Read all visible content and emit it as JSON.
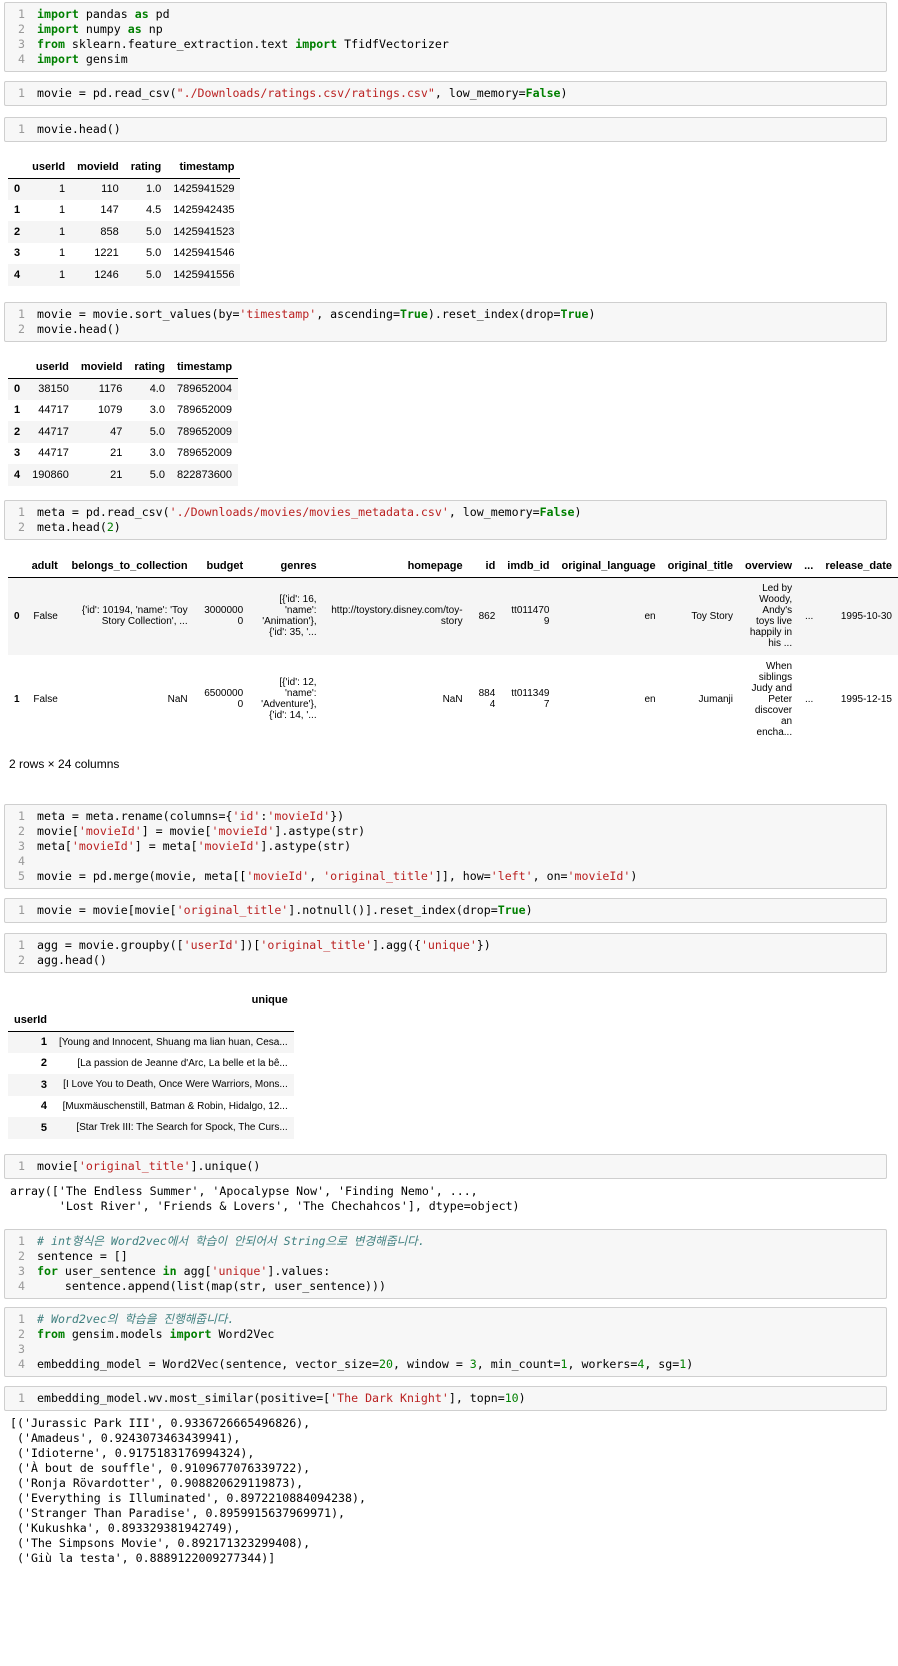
{
  "cells": {
    "c1": [
      "import pandas as pd",
      "import numpy as np",
      "from sklearn.feature_extraction.text import TfidfVectorizer",
      "import gensim"
    ],
    "c2": [
      "movie = pd.read_csv(\"./Downloads/ratings.csv/ratings.csv\", low_memory=False)"
    ],
    "c3": [
      "movie.head()"
    ],
    "c4": [
      "movie = movie.sort_values(by='timestamp', ascending=True).reset_index(drop=True)",
      "movie.head()"
    ],
    "c5": [
      "meta = pd.read_csv('./Downloads/movies/movies_metadata.csv', low_memory=False)",
      "meta.head(2)"
    ],
    "c6": [
      "meta = meta.rename(columns={'id':'movieId'})",
      "movie['movieId'] = movie['movieId'].astype(str)",
      "meta['movieId'] = meta['movieId'].astype(str)",
      "",
      "movie = pd.merge(movie, meta[['movieId', 'original_title']], how='left', on='movieId')"
    ],
    "c7": [
      "movie = movie[movie['original_title'].notnull()].reset_index(drop=True)"
    ],
    "c8": [
      "agg = movie.groupby(['userId'])['original_title'].agg({'unique'})",
      "agg.head()"
    ],
    "c9": [
      "movie['original_title'].unique()"
    ],
    "c10": [
      "# int형식은 Word2vec에서 학습이 안되어서 String으로 변경해줍니다.",
      "sentence = []",
      "for user_sentence in agg['unique'].values:",
      "    sentence.append(list(map(str, user_sentence)))"
    ],
    "c11": [
      "# Word2vec의 학습을 진행해줍니다.",
      "from gensim.models import Word2Vec",
      "",
      "embedding_model = Word2Vec(sentence, vector_size=20, window = 3, min_count=1, workers=4, sg=1)"
    ],
    "c12": [
      "embedding_model.wv.most_similar(positive=['The Dark Knight'], topn=10)"
    ]
  },
  "df1": {
    "columns": [
      "userId",
      "movieId",
      "rating",
      "timestamp"
    ],
    "rows": [
      [
        "0",
        "1",
        "110",
        "1.0",
        "1425941529"
      ],
      [
        "1",
        "1",
        "147",
        "4.5",
        "1425942435"
      ],
      [
        "2",
        "1",
        "858",
        "5.0",
        "1425941523"
      ],
      [
        "3",
        "1",
        "1221",
        "5.0",
        "1425941546"
      ],
      [
        "4",
        "1",
        "1246",
        "5.0",
        "1425941556"
      ]
    ]
  },
  "df2": {
    "columns": [
      "userId",
      "movieId",
      "rating",
      "timestamp"
    ],
    "rows": [
      [
        "0",
        "38150",
        "1176",
        "4.0",
        "789652004"
      ],
      [
        "1",
        "44717",
        "1079",
        "3.0",
        "789652009"
      ],
      [
        "2",
        "44717",
        "47",
        "5.0",
        "789652009"
      ],
      [
        "3",
        "44717",
        "21",
        "3.0",
        "789652009"
      ],
      [
        "4",
        "190860",
        "21",
        "5.0",
        "822873600"
      ]
    ]
  },
  "df3": {
    "columns": [
      "adult",
      "belongs_to_collection",
      "budget",
      "genres",
      "homepage",
      "id",
      "imdb_id",
      "original_language",
      "original_title",
      "overview",
      "...",
      "release_date"
    ],
    "rows": [
      [
        "0",
        "False",
        "{'id': 10194, 'name': 'Toy Story Collection', ...",
        "30000000",
        "[{'id': 16, 'name': 'Animation'}, {'id': 35, '...",
        "http://toystory.disney.com/toy-story",
        "862",
        "tt0114709",
        "en",
        "Toy Story",
        "Led by Woody, Andy's toys live happily in his ...",
        "...",
        "1995-10-30"
      ],
      [
        "1",
        "False",
        "NaN",
        "65000000",
        "[{'id': 12, 'name': 'Adventure'}, {'id': 14, '...",
        "NaN",
        "8844",
        "tt0113497",
        "en",
        "Jumanji",
        "When siblings Judy and Peter discover an encha...",
        "...",
        "1995-12-15"
      ]
    ],
    "shape": "2 rows × 24 columns"
  },
  "df4": {
    "column": "unique",
    "index_name": "userId",
    "rows": [
      [
        "1",
        "[Young and Innocent, Shuang ma lian huan, Cesa..."
      ],
      [
        "2",
        "[La passion de Jeanne d'Arc, La belle et la bê..."
      ],
      [
        "3",
        "[I Love You to Death, Once Were Warriors, Mons..."
      ],
      [
        "4",
        "[Muxmäuschenstill, Batman & Robin, Hidalgo, 12..."
      ],
      [
        "5",
        "[Star Trek III: The Search for Spock, The Curs..."
      ]
    ]
  },
  "out9": [
    "array(['The Endless Summer', 'Apocalypse Now', 'Finding Nemo', ...,",
    "       'Lost River', 'Friends & Lovers', 'The Chechahcos'], dtype=object)"
  ],
  "out12": [
    "[('Jurassic Park III', 0.9336726665496826),",
    " ('Amadeus', 0.9243073463439941),",
    " ('Idioterne', 0.9175183176994324),",
    " ('À bout de souffle', 0.9109677076339722),",
    " ('Ronja Rövardotter', 0.908820629119873),",
    " ('Everything is Illuminated', 0.8972210884094238),",
    " ('Stranger Than Paradise', 0.8959915637969971),",
    " ('Kukushka', 0.893329381942749),",
    " ('The Simpsons Movie', 0.892171323299408),",
    " ('Giù la testa', 0.8889122009277344)]"
  ],
  "icons": [
    "scroll-left-icon",
    "scroll-right-icon"
  ]
}
